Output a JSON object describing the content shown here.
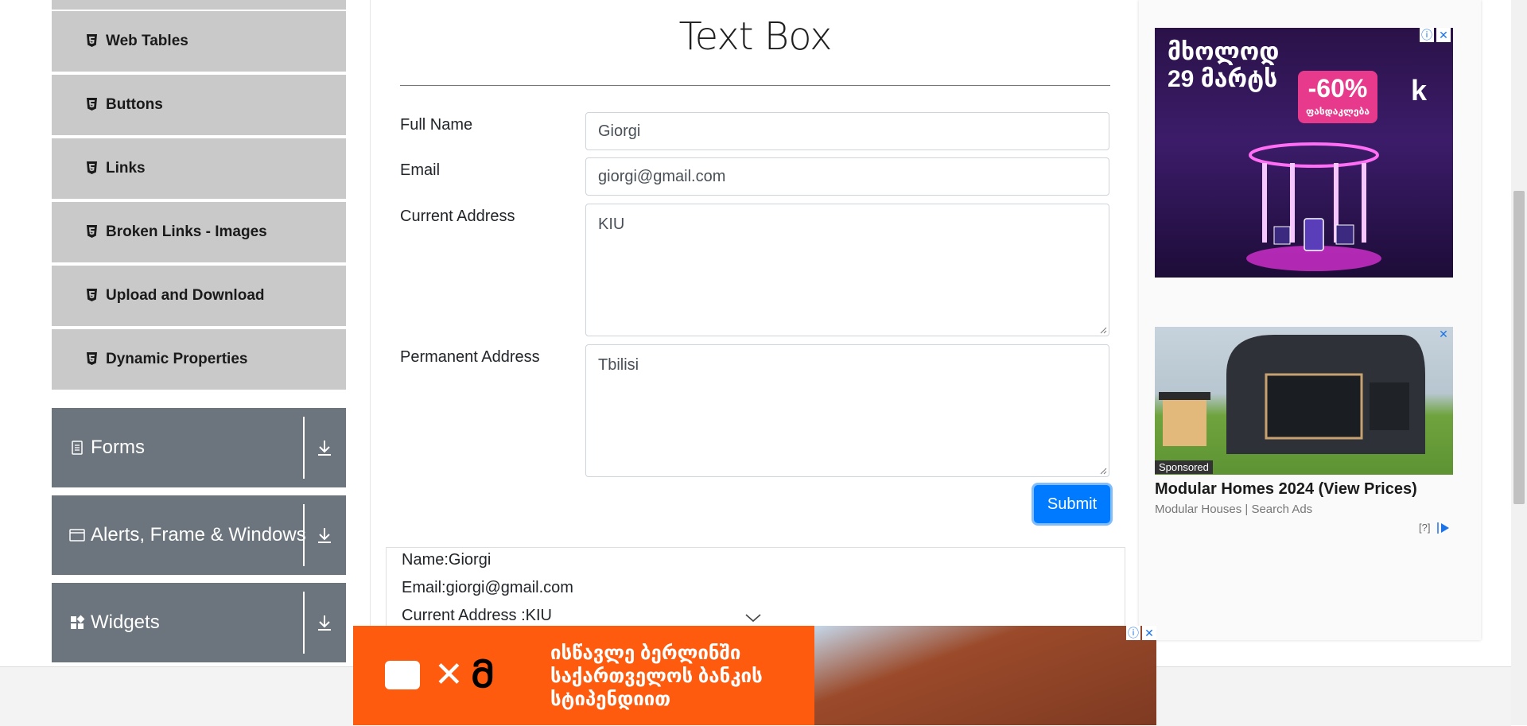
{
  "sidebar": {
    "sub_items": [
      {
        "label": "Web Tables"
      },
      {
        "label": "Buttons"
      },
      {
        "label": "Links"
      },
      {
        "label": "Broken Links - Images"
      },
      {
        "label": "Upload and Download"
      },
      {
        "label": "Dynamic Properties"
      }
    ],
    "groups": [
      {
        "label": "Forms"
      },
      {
        "label": "Alerts, Frame & Windows"
      },
      {
        "label": "Widgets"
      }
    ]
  },
  "main": {
    "title": "Text Box",
    "fields": {
      "full_name": {
        "label": "Full Name",
        "value": "Giorgi"
      },
      "email": {
        "label": "Email",
        "value": "giorgi@gmail.com"
      },
      "current_address": {
        "label": "Current Address",
        "value": "KIU"
      },
      "permanent_address": {
        "label": "Permanent Address",
        "value": "Tbilisi"
      }
    },
    "submit_label": "Submit",
    "output": {
      "name": "Name:Giorgi",
      "email": "Email:giorgi@gmail.com",
      "current_address": "Current Address :KIU"
    }
  },
  "ads": {
    "ad1": {
      "text_line1": "მხოლოდ",
      "text_line2": "29 მარტს",
      "badge_percent": "-60%",
      "badge_sub": "ფასდაკლება",
      "logo": "k"
    },
    "ad2": {
      "sponsored": "Sponsored",
      "title": "Modular Homes 2024 (View Prices)",
      "source": "Modular Houses | Search Ads",
      "help": "[?]"
    },
    "ad3": {
      "line1": "ისწავლე ბერლინში",
      "line2": "საქართველოს ბანკის",
      "line3": "სტიპენდიით"
    },
    "close_glyph": "✕",
    "info_glyph": "ⓘ"
  },
  "colors": {
    "submit": "#007bff",
    "group_bg": "#6c757d",
    "sub_item_bg": "#c9c9c9",
    "ad3_bg": "#ff5b0f"
  }
}
